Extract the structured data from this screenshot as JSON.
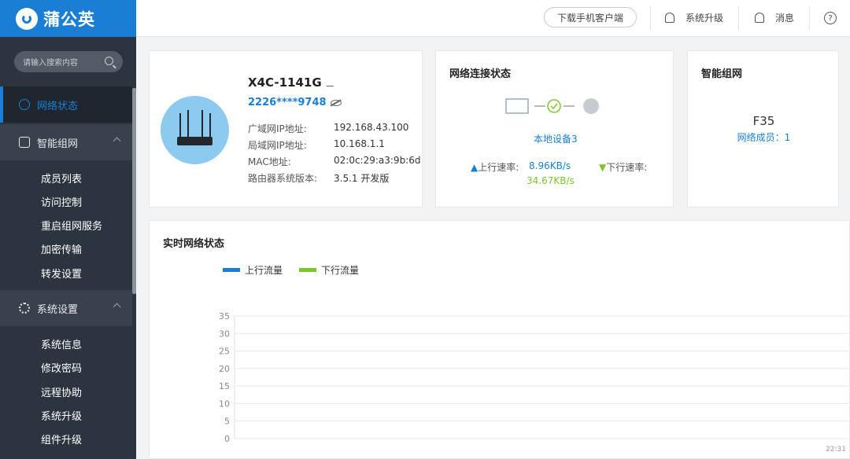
{
  "logo": {
    "text": "蒲公英"
  },
  "search": {
    "placeholder": "请输入搜索内容"
  },
  "sidebar": {
    "active": "网络状态",
    "groups": [
      {
        "label": "智能组网",
        "items": [
          "成员列表",
          "访问控制",
          "重启组网服务",
          "加密传输",
          "转发设置"
        ]
      },
      {
        "label": "系统设置",
        "items": [
          "系统信息",
          "修改密码",
          "远程协助",
          "系统升级",
          "组件升级"
        ]
      }
    ]
  },
  "topbar": {
    "download": "下载手机客户端",
    "upgrade": "系统升级",
    "messages": "消息"
  },
  "device": {
    "name": "X4C-1141G",
    "id": "2226****9748",
    "rows": [
      {
        "label": "广域网IP地址:",
        "value": "192.168.43.100"
      },
      {
        "label": "局域网IP地址:",
        "value": "10.168.1.1"
      },
      {
        "label": "MAC地址:",
        "value": "02:0c:29:a3:9b:6d"
      },
      {
        "label": "路由器系统版本:",
        "value": "3.5.1 开发版"
      }
    ]
  },
  "network": {
    "title": "网络连接状态",
    "local_devices": "本地设备3",
    "up_label": "上行速率:",
    "up_value": "8.96KB/s",
    "down_label": "下行速率:",
    "down_value": "34.67KB/s"
  },
  "mesh": {
    "title": "智能组网",
    "name": "F35",
    "members": "网络成员：1"
  },
  "realtime": {
    "title": "实时网络状态",
    "time": "22:31"
  },
  "colors": {
    "accent": "#1a7fd4",
    "download": "#7cc52b"
  },
  "chart_data": {
    "type": "line",
    "series": [
      {
        "name": "上行流量",
        "color": "#1a7fd4",
        "values": []
      },
      {
        "name": "下行流量",
        "color": "#7cc52b",
        "values": []
      }
    ],
    "yticks": [
      "0",
      "5",
      "10",
      "15",
      "20",
      "25",
      "30",
      "35"
    ],
    "ylim": [
      0,
      35
    ],
    "grid": true,
    "legend": "top-left"
  }
}
